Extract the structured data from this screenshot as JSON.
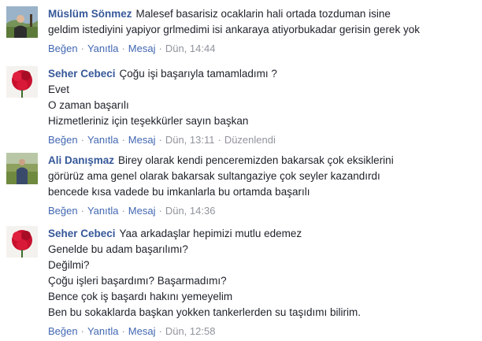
{
  "comments": [
    {
      "author": "Müslüm Sönmez",
      "avatar": "avatar-man-outdoor",
      "first_line": "Malesef basarisiz ocaklarin hali ortada tozduman isine",
      "more_lines": [
        "geldim istediyini yapiyor grlmedimi isi ankaraya atiyorbukadar gerisin gerek yok"
      ],
      "actions": {
        "like": "Beğen",
        "reply": "Yanıtla",
        "message": "Mesaj"
      },
      "time": "Dün, 14:44"
    },
    {
      "author": "Seher Cebeci",
      "avatar": "avatar-red-flowers",
      "first_line": "Çoğu işi başarıyla tamamladımı ?",
      "more_lines": [
        "Evet",
        "O zaman başarılı",
        "Hizmetleriniz için teşekkürler sayın başkan"
      ],
      "actions": {
        "like": "Beğen",
        "reply": "Yanıtla",
        "message": "Mesaj"
      },
      "time": "Dün, 13:11",
      "edited": "Düzenlendi"
    },
    {
      "author": "Ali Danışmaz",
      "avatar": "avatar-man-field",
      "first_line": "Birey olarak kendi penceremizden bakarsak çok eksiklerini",
      "more_lines": [
        "görürüz ama genel olarak bakarsak sultangaziye çok seyler kazandırdı",
        "bencede kısa vadede bu imkanlarla bu ortamda başarılı"
      ],
      "actions": {
        "like": "Beğen",
        "reply": "Yanıtla",
        "message": "Mesaj"
      },
      "time": "Dün, 14:36"
    },
    {
      "author": "Seher Cebeci",
      "avatar": "avatar-red-flowers",
      "first_line": "Yaa arkadaşlar hepimizi mutlu edemez",
      "more_lines": [
        "Genelde bu adam başarılımı?",
        "Değilmi?",
        "Çoğu işleri başardımı? Başarmadımı?",
        "Bence çok iş başardı hakını yemeyelim",
        "Ben bu sokaklarda başkan yokken tankerlerden su taşıdımı bilirim."
      ],
      "actions": {
        "like": "Beğen",
        "reply": "Yanıtla",
        "message": "Mesaj"
      },
      "time": "Dün, 12:58"
    }
  ]
}
